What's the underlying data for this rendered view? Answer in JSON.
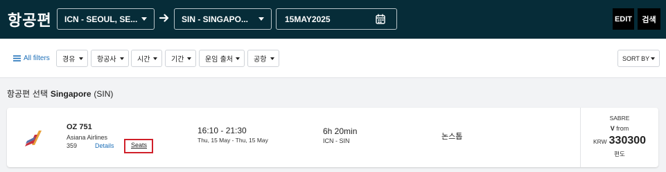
{
  "header": {
    "title": "항공편",
    "origin": "ICN - SEOUL, SE...",
    "destination": "SIN - SINGAPO...",
    "date": "15MAY2025",
    "edit_label": "EDIT",
    "search_label": "검색"
  },
  "filters": {
    "all_filters_label": "All filters",
    "chips": [
      "경유",
      "항공사",
      "시간",
      "기간",
      "운임 출처",
      "공항"
    ],
    "sort_label": "SORT BY"
  },
  "results": {
    "title_prefix": "항공편 선택",
    "city": "Singapore",
    "code": "(SIN)"
  },
  "flight": {
    "flight_no": "OZ 751",
    "airline": "Asiana Airlines",
    "number": "359",
    "details_label": "Details",
    "seats_label": "Seats",
    "time": "16:10 - 21:30",
    "dates": "Thu, 15 May - Thu, 15 May",
    "duration": "6h 20min",
    "route": "ICN - SIN",
    "stops": "논스톱",
    "source": "SABRE",
    "fare_class": "V",
    "from_label": "from",
    "currency": "KRW",
    "price": "330300",
    "trip_type": "편도"
  },
  "colors": {
    "header_bg": "#062c38",
    "link": "#1d6fb8",
    "highlight": "#d0202a"
  }
}
